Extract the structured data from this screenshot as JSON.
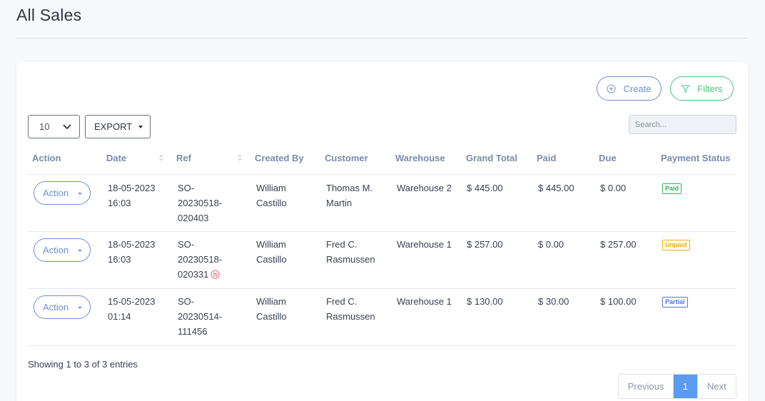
{
  "page": {
    "title": "All Sales"
  },
  "toolbar": {
    "create_label": "Create",
    "filters_label": "Filters",
    "page_length": "10",
    "export_label": "EXPORT",
    "search_placeholder": "Search..."
  },
  "table": {
    "columns": [
      "Action",
      "Date",
      "Ref",
      "Created By",
      "Customer",
      "Warehouse",
      "Grand Total",
      "Paid",
      "Due",
      "Payment Status"
    ],
    "rows": [
      {
        "action": "Action",
        "date": [
          "18-05-2023",
          "16:03"
        ],
        "ref": [
          "SO-",
          "20230518-",
          "020403"
        ],
        "created_by": [
          "William",
          "Castillo"
        ],
        "customer": [
          "Thomas M.",
          "Martin"
        ],
        "warehouse": "Warehouse 2",
        "grand_total": "$ 445.00",
        "paid": "$ 445.00",
        "due": "$ 0.00",
        "status": "Paid",
        "has_return": false
      },
      {
        "action": "Action",
        "date": [
          "18-05-2023",
          "16:03"
        ],
        "ref": [
          "SO-",
          "20230518-",
          "020331"
        ],
        "created_by": [
          "William",
          "Castillo"
        ],
        "customer": [
          "Fred C.",
          "Rasmussen"
        ],
        "warehouse": "Warehouse 1",
        "grand_total": "$ 257.00",
        "paid": "$ 0.00",
        "due": "$ 257.00",
        "status": "Unpaid",
        "has_return": true
      },
      {
        "action": "Action",
        "date": [
          "15-05-2023",
          "01:14"
        ],
        "ref": [
          "SO-",
          "20230514-",
          "111456"
        ],
        "created_by": [
          "William",
          "Castillo"
        ],
        "customer": [
          "Fred C.",
          "Rasmussen"
        ],
        "warehouse": "Warehouse 1",
        "grand_total": "$ 130.00",
        "paid": "$ 30.00",
        "due": "$ 100.00",
        "status": "Partial",
        "has_return": false
      }
    ]
  },
  "footer": {
    "showing": "Showing 1 to 3 of 3 entries",
    "prev_label": "Previous",
    "current_page": "1",
    "next_label": "Next"
  },
  "colors": {
    "primary": "#6c8fd6",
    "success": "#4bc47a",
    "paid": "#2fb55a",
    "unpaid": "#e8b200",
    "partial": "#4a7ad8",
    "page_active": "#5b9bf0"
  }
}
